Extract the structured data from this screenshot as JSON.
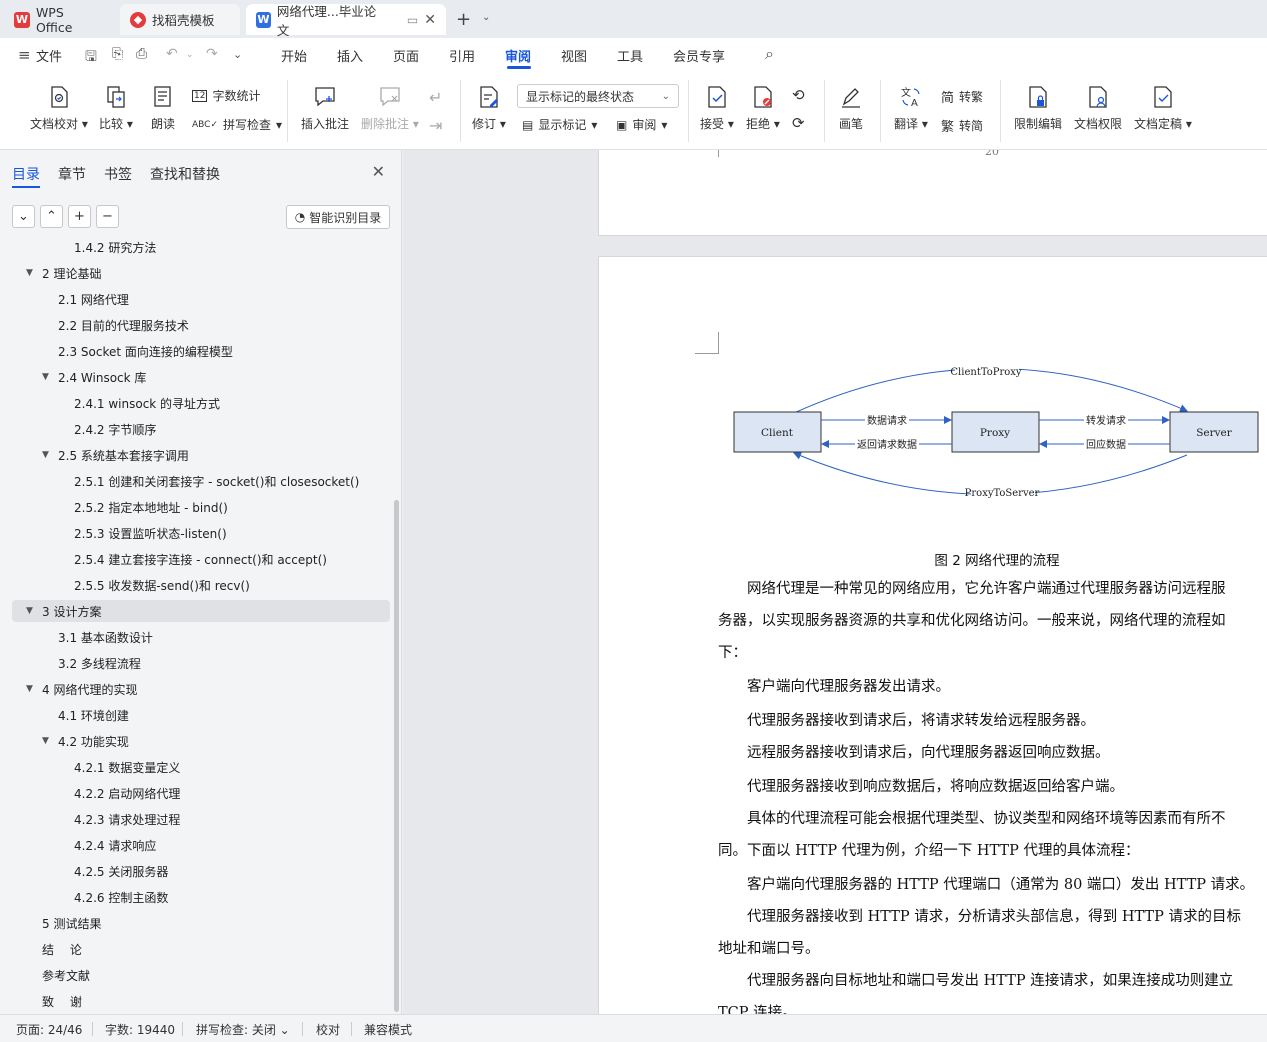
{
  "tabs": [
    {
      "label": "WPS Office"
    },
    {
      "label": "找稻壳模板"
    },
    {
      "label": "网络代理...毕业论文"
    }
  ],
  "menu": {
    "file": "文件",
    "items": [
      "开始",
      "插入",
      "页面",
      "引用",
      "审阅",
      "视图",
      "工具",
      "会员专享"
    ],
    "active": "审阅"
  },
  "ribbon": {
    "proofread": "文档校对",
    "compare": "比较",
    "read_aloud": "朗读",
    "word_count": "字数统计",
    "spell_check": "拼写检查",
    "insert_comment": "插入批注",
    "delete_comment": "删除批注",
    "revise": "修订",
    "show_mode": "显示标记的最终状态",
    "show_marks": "显示标记",
    "review": "审阅",
    "accept": "接受",
    "reject": "拒绝",
    "pen": "画笔",
    "translate": "翻译",
    "to_traditional": "转繁",
    "to_simplified": "转简",
    "restrict_edit": "限制编辑",
    "doc_permission": "文档权限",
    "finalize": "文档定稿",
    "simp_char": "简",
    "trad_char": "繁"
  },
  "nav": {
    "tabs": [
      "目录",
      "章节",
      "书签",
      "查找和替换"
    ],
    "smart_toc": "智能识别目录",
    "items": [
      {
        "text": "1.4.2 研究方法",
        "level": 2,
        "arrow": ""
      },
      {
        "text": "2 理论基础",
        "level": 0,
        "arrow": "▼"
      },
      {
        "text": "2.1 网络代理",
        "level": 1,
        "arrow": ""
      },
      {
        "text": "2.2 目前的代理服务技术",
        "level": 1,
        "arrow": ""
      },
      {
        "text": "2.3 Socket 面向连接的编程模型",
        "level": 1,
        "arrow": ""
      },
      {
        "text": "2.4 Winsock 库",
        "level": 1,
        "arrow": "▼"
      },
      {
        "text": "2.4.1 winsock 的寻址方式",
        "level": 2,
        "arrow": ""
      },
      {
        "text": "2.4.2 字节顺序",
        "level": 2,
        "arrow": ""
      },
      {
        "text": "2.5 系统基本套接字调用",
        "level": 1,
        "arrow": "▼"
      },
      {
        "text": "2.5.1 创建和关闭套接字 - socket()和 closesocket()",
        "level": 2,
        "arrow": ""
      },
      {
        "text": "2.5.2 指定本地地址 - bind()",
        "level": 2,
        "arrow": ""
      },
      {
        "text": "2.5.3 设置监听状态-listen()",
        "level": 2,
        "arrow": ""
      },
      {
        "text": "2.5.4 建立套接字连接 - connect()和 accept()",
        "level": 2,
        "arrow": ""
      },
      {
        "text": "2.5.5 收发数据-send()和 recv()",
        "level": 2,
        "arrow": ""
      },
      {
        "text": "3 设计方案",
        "level": 0,
        "arrow": "▼",
        "selected": true
      },
      {
        "text": "3.1 基本函数设计",
        "level": 1,
        "arrow": ""
      },
      {
        "text": "3.2 多线程流程",
        "level": 1,
        "arrow": ""
      },
      {
        "text": "4 网络代理的实现",
        "level": 0,
        "arrow": "▼"
      },
      {
        "text": "4.1 环境创建",
        "level": 1,
        "arrow": ""
      },
      {
        "text": "4.2 功能实现",
        "level": 1,
        "arrow": "▼"
      },
      {
        "text": "4.2.1 数据变量定义",
        "level": 2,
        "arrow": ""
      },
      {
        "text": "4.2.2 启动网络代理",
        "level": 2,
        "arrow": ""
      },
      {
        "text": "4.2.3 请求处理过程",
        "level": 2,
        "arrow": ""
      },
      {
        "text": "4.2.4 请求响应",
        "level": 2,
        "arrow": ""
      },
      {
        "text": "4.2.5 关闭服务器",
        "level": 2,
        "arrow": ""
      },
      {
        "text": "4.2.6 控制主函数",
        "level": 2,
        "arrow": ""
      },
      {
        "text": "5 测试结果",
        "level": 0,
        "arrow": ""
      },
      {
        "text": "结　 论",
        "level": 0,
        "arrow": ""
      },
      {
        "text": "参考文献",
        "level": 0,
        "arrow": ""
      },
      {
        "text": "致　 谢",
        "level": 0,
        "arrow": ""
      }
    ]
  },
  "document": {
    "prev_page_number": "20",
    "diagram": {
      "nodes": [
        "Client",
        "Proxy",
        "Server"
      ],
      "top_arc": "ClientToProxy",
      "bottom_arc": "ProxyToServer",
      "client_to_proxy": "数据请求",
      "proxy_to_client": "返回请求数据",
      "proxy_to_server": "转发请求",
      "server_to_proxy": "回应数据"
    },
    "caption": "图 2  网络代理的流程",
    "paragraphs": [
      "　　网络代理是一种常见的网络应用，它允许客户端通过代理服务器访问远程服",
      "务器，以实现服务器资源的共享和优化网络访问。一般来说，网络代理的流程如",
      "下：",
      "　　客户端向代理服务器发出请求。",
      "　　代理服务器接收到请求后，将请求转发给远程服务器。",
      "　　远程服务器接收到请求后，向代理服务器返回响应数据。",
      "　　代理服务器接收到响应数据后，将响应数据返回给客户端。",
      "　　具体的代理流程可能会根据代理类型、协议类型和网络环境等因素而有所不",
      "同。下面以 HTTP 代理为例，介绍一下 HTTP 代理的具体流程：",
      "　　客户端向代理服务器的 HTTP 代理端口（通常为 80 端口）发出 HTTP 请求。",
      "　　代理服务器接收到 HTTP 请求，分析请求头部信息，得到 HTTP 请求的目标",
      "地址和端口号。",
      "　　代理服务器向目标地址和端口号发出 HTTP 连接请求，如果连接成功则建立",
      "TCP 连接。"
    ]
  },
  "status": {
    "page": "页面: 24/46",
    "words": "字数: 19440",
    "spell": "拼写检查: 关闭",
    "proof": "校对",
    "compat": "兼容模式"
  },
  "colors": {
    "accent": "#1a56db",
    "wps_red": "#e23c3c",
    "doc_blue": "#2f6fe0",
    "diagram_box": "#dbe5f3",
    "diagram_line": "#2e62c4"
  }
}
